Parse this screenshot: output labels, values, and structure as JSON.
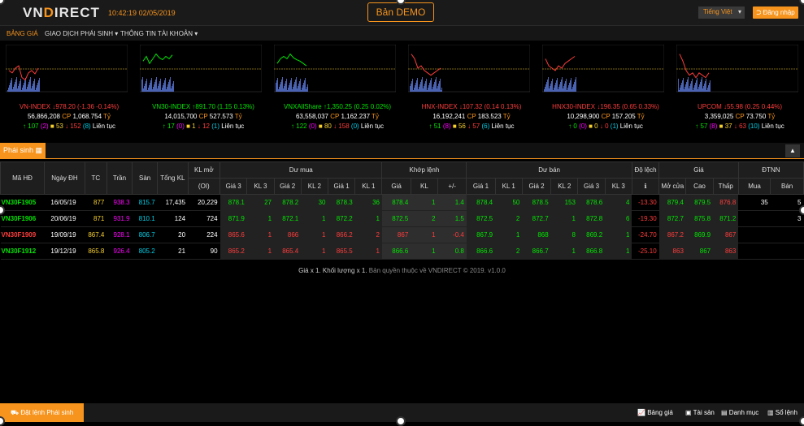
{
  "header": {
    "logo_a": "VN",
    "logo_b": "D",
    "logo_c": "IRECT",
    "time": "10:42:19",
    "date": "02/05/2019",
    "demo": "Bản DEMO",
    "lang": "Tiếng Việt",
    "login": "Đăng nhập"
  },
  "menu": [
    "BẢNG GIÁ",
    "GIAO DỊCH PHÁI SINH",
    "THÔNG TIN TÀI KHOẢN"
  ],
  "indices": [
    {
      "name": "VN-INDEX",
      "dir": "dn",
      "arrow": "↓",
      "value": "978.20",
      "change": "(-1.36 -0.14%)",
      "vol": "56,866,208",
      "cp": "CP",
      "val": "1,068.754",
      "unit": "Tỷ",
      "up": "107",
      "upc": "(2)",
      "ref": "53",
      "dn": "152",
      "dnc": "(8)",
      "status": "Liên tục"
    },
    {
      "name": "VN30-INDEX",
      "dir": "up",
      "arrow": "↑",
      "value": "891.70",
      "change": "(1.15 0.13%)",
      "vol": "14,015,700",
      "cp": "CP",
      "val": "527.573",
      "unit": "Tỷ",
      "up": "17",
      "upc": "(0)",
      "ref": "1",
      "dn": "12",
      "dnc": "(1)",
      "status": "Liên tục"
    },
    {
      "name": "VNXAllShare",
      "dir": "up",
      "arrow": "↑",
      "value": "1,350.25",
      "change": "(0.25 0.02%)",
      "vol": "63,558,037",
      "cp": "CP",
      "val": "1,162.237",
      "unit": "Tỷ",
      "up": "122",
      "upc": "(0)",
      "ref": "80",
      "dn": "158",
      "dnc": "(0)",
      "status": "Liên tục"
    },
    {
      "name": "HNX-INDEX",
      "dir": "dn",
      "arrow": "↓",
      "value": "107.32",
      "change": "(0.14 0.13%)",
      "vol": "16,192,241",
      "cp": "CP",
      "val": "183.523",
      "unit": "Tỷ",
      "up": "51",
      "upc": "(8)",
      "ref": "56",
      "dn": "57",
      "dnc": "(6)",
      "status": "Liên tục"
    },
    {
      "name": "HNX30-INDEX",
      "dir": "dn",
      "arrow": "↓",
      "value": "196.35",
      "change": "(0.65 0.33%)",
      "vol": "10,298,900",
      "cp": "CP",
      "val": "157.205",
      "unit": "Tỷ",
      "up": "0",
      "upc": "(0)",
      "ref": "0",
      "dn": "0",
      "dnc": "(1)",
      "status": "Liên tục"
    },
    {
      "name": "UPCOM",
      "dir": "dn",
      "arrow": "↓",
      "value": "55.98",
      "change": "(0.25 0.44%)",
      "vol": "3,359,025",
      "cp": "CP",
      "val": "73.750",
      "unit": "Tỷ",
      "up": "57",
      "upc": "(8)",
      "ref": "37",
      "dn": "63",
      "dnc": "(10)",
      "status": "Liên tục"
    }
  ],
  "tab": {
    "label": "Phái sinh"
  },
  "table": {
    "h_ma": "Mã HĐ",
    "h_ngay": "Ngày ĐH",
    "h_tc": "TC",
    "h_tran": "Trần",
    "h_san": "Sàn",
    "h_tkl": "Tổng KL",
    "h_klmo": "KL mở",
    "h_oi": "(OI)",
    "h_dumua": "Dư mua",
    "h_khop": "Khớp lệnh",
    "h_duban": "Dư bán",
    "h_dolech": "Độ lệch",
    "h_gia": "Giá",
    "h_dtnn": "ĐTNN",
    "h_sub": [
      "Giá 3",
      "KL 3",
      "Giá 2",
      "KL 2",
      "Giá 1",
      "KL 1",
      "Giá",
      "KL",
      "+/-",
      "Giá 1",
      "KL 1",
      "Giá 2",
      "KL 2",
      "Giá 3",
      "KL 3",
      "ℹ",
      "Mở cửa",
      "Cao",
      "Thấp",
      "Mua",
      "Bán"
    ],
    "rows": [
      {
        "cells": [
          "VN30F1905",
          "16/05/19",
          "877",
          "938.3",
          "815.7",
          "17,435",
          "20,229",
          "878.1",
          "27",
          "878.2",
          "30",
          "878.3",
          "36",
          "878.4",
          "1",
          "1.4",
          "878.4",
          "50",
          "878.5",
          "153",
          "878.6",
          "4",
          "-13.30",
          "879.4",
          "879.5",
          "876.8",
          "35",
          "5"
        ],
        "cls": [
          "up",
          "wh",
          "ref",
          "ceil",
          "flr",
          "wh",
          "wh",
          "up",
          "up",
          "up",
          "up",
          "up",
          "up",
          "up",
          "up",
          "up",
          "up",
          "up",
          "up",
          "up",
          "up",
          "up",
          "dn",
          "up",
          "up",
          "dn",
          "wh",
          "wh"
        ]
      },
      {
        "cells": [
          "VN30F1906",
          "20/06/19",
          "871",
          "931.9",
          "810.1",
          "124",
          "724",
          "871.9",
          "1",
          "872.1",
          "1",
          "872.2",
          "1",
          "872.5",
          "2",
          "1.5",
          "872.5",
          "2",
          "872.7",
          "1",
          "872.8",
          "6",
          "-19.30",
          "872.7",
          "875.8",
          "871.2",
          "",
          "3"
        ],
        "cls": [
          "up",
          "wh",
          "ref",
          "ceil",
          "flr",
          "wh",
          "wh",
          "up",
          "up",
          "up",
          "up",
          "up",
          "up",
          "up",
          "up",
          "up",
          "up",
          "up",
          "up",
          "up",
          "up",
          "up",
          "dn",
          "up",
          "up",
          "up",
          "wh",
          "wh"
        ]
      },
      {
        "cells": [
          "VN30F1909",
          "19/09/19",
          "867.4",
          "928.1",
          "806.7",
          "20",
          "224",
          "865.6",
          "1",
          "866",
          "1",
          "866.2",
          "2",
          "867",
          "1",
          "-0.4",
          "867.9",
          "1",
          "868",
          "8",
          "869.2",
          "1",
          "-24.70",
          "867.2",
          "869.9",
          "867",
          "",
          ""
        ],
        "cls": [
          "dn",
          "wh",
          "ref",
          "ceil",
          "flr",
          "wh",
          "wh",
          "dn",
          "dn",
          "dn",
          "dn",
          "dn",
          "dn",
          "dn",
          "dn",
          "dn",
          "up",
          "up",
          "up",
          "up",
          "up",
          "up",
          "dn",
          "dn",
          "up",
          "dn",
          "wh",
          "wh"
        ]
      },
      {
        "cells": [
          "VN30F1912",
          "19/12/19",
          "865.8",
          "926.4",
          "805.2",
          "21",
          "90",
          "865.2",
          "1",
          "865.4",
          "1",
          "865.5",
          "1",
          "866.6",
          "1",
          "0.8",
          "866.6",
          "2",
          "866.7",
          "1",
          "866.8",
          "1",
          "-25.10",
          "863",
          "867",
          "863",
          "",
          ""
        ],
        "cls": [
          "up",
          "wh",
          "ref",
          "ceil",
          "flr",
          "wh",
          "wh",
          "dn",
          "dn",
          "dn",
          "dn",
          "dn",
          "dn",
          "up",
          "up",
          "up",
          "up",
          "up",
          "up",
          "up",
          "up",
          "up",
          "dn",
          "dn",
          "up",
          "dn",
          "wh",
          "wh"
        ]
      }
    ]
  },
  "footer": {
    "text": "Giá x 1. Khối lượng x 1.",
    "copy": "Bản quyền thuộc về VNDIRECT © 2019. v1.0.0"
  },
  "bottom": {
    "order": "Đặt lệnh Phái sinh",
    "b1": "Bảng giá",
    "b2": "Tài sản",
    "b3": "Danh mục",
    "b4": "Sổ lệnh"
  }
}
